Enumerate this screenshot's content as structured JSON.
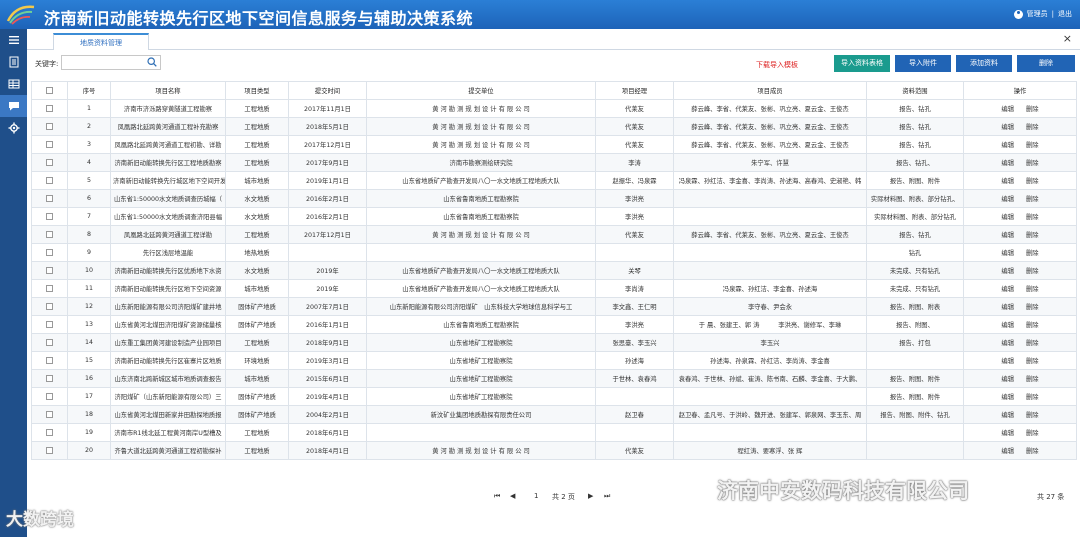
{
  "header": {
    "title": "济南新旧动能转换先行区地下空间信息服务与辅助决策系统",
    "user": "管理员",
    "logout": "退出"
  },
  "sidebar": {
    "items": [
      {
        "name": "menu-icon"
      },
      {
        "name": "document-icon"
      },
      {
        "name": "table-icon"
      },
      {
        "name": "chat-icon"
      },
      {
        "name": "gear-icon"
      }
    ]
  },
  "tab": {
    "label": "地质资料管理",
    "close": "×"
  },
  "toolbar": {
    "keyword_label": "关键字:",
    "keyword_value": "",
    "download_template": "下载导入模板",
    "import_table": "导入资料表格",
    "import_attach": "导入附件",
    "add": "添加资料",
    "delete": "删除"
  },
  "table": {
    "headers": [
      "",
      "序号",
      "项目名称",
      "项目类型",
      "提交时间",
      "提交单位",
      "项目经理",
      "项目成员",
      "资料范围",
      "操作"
    ],
    "edit_label": "编辑",
    "delete_label": "删除",
    "rows": [
      [
        "1",
        "济南市济泺路穿黄隧道工程勘察",
        "工程地质",
        "2017年11月1日",
        "黄 河 勘 测 规 划 设 计 有 限 公 司",
        "代莱友",
        "薛云峰、李省、代莱友、张彬、巩立亮、夏云金、王俊杰",
        "报告、钻孔"
      ],
      [
        "2",
        "凤凰路北延跨黄河通道工程补充勘察",
        "工程地质",
        "2018年5月1日",
        "黄 河 勘 测 规 划 设 计 有 限 公 司",
        "代莱友",
        "薛云峰、李省、代莱友、张彬、巩立亮、夏云金、王俊杰",
        "报告、钻孔"
      ],
      [
        "3",
        "凤凰路北延跨黄河通道工程初勘、详勘",
        "工程地质",
        "2017年12月1日",
        "黄 河 勘 测 规 划 设 计 有 限 公 司",
        "代莱友",
        "薛云峰、李省、代莱友、张彬、巩立亮、夏云金、王俊杰",
        "报告、钻孔"
      ],
      [
        "4",
        "济南新旧动能转换先行区工程地质勘察",
        "工程地质",
        "2017年9月1日",
        "济南市勘察测绘研究院",
        "李涛",
        "朱宁军、许慧",
        "报告、钻孔、"
      ],
      [
        "5",
        "济南新旧动能转换先行城区地下空间开发",
        "城市地质",
        "2019年1月1日",
        "山东省地质矿产勘查开发局八〇一水文地质工程地质大队",
        "赵振华、冯泉霖",
        "冯泉霖、孙红洁、李金喜、李尚涛、孙述海、高春鸿、史淑艳、韩",
        "报告、附图、附件"
      ],
      [
        "6",
        "山东省1:50000水文地质调查历城幅（",
        "水文地质",
        "2016年2月1日",
        "山东省鲁南地质工程勘察院",
        "李洪亮",
        "",
        "实际材料图、附表、部分钻孔、"
      ],
      [
        "7",
        "山东省1:50000水文地质调查济阳县幅",
        "水文地质",
        "2016年2月1日",
        "山东省鲁南地质工程勘察院",
        "李洪亮",
        "",
        "实际材料图、附表、部分钻孔"
      ],
      [
        "8",
        "凤凰路北延跨黄河通道工程详勘",
        "工程地质",
        "2017年12月1日",
        "黄 河 勘 测 规 划 设 计 有 限 公 司",
        "代莱友",
        "薛云峰、李省、代莱友、张彬、巩立亮、夏云金、王俊杰",
        "报告、钻孔"
      ],
      [
        "9",
        "先行区浅层地温能",
        "地热地质",
        "",
        "",
        "",
        "",
        "钻孔"
      ],
      [
        "10",
        "济南新旧动能转换先行区优质地下水资",
        "水文地质",
        "2019年",
        "山东省地质矿产勘查开发局八〇一水文地质工程地质大队",
        "关琴",
        "",
        "未完成、只有钻孔"
      ],
      [
        "11",
        "济南新旧动能转换先行区地下空间资源",
        "城市地质",
        "2019年",
        "山东省地质矿产勘查开发局八〇一水文地质工程地质大队",
        "李尚涛",
        "冯泉霖、孙红洁、李金喜、孙述海",
        "未完成、只有钻孔"
      ],
      [
        "12",
        "山东新阳能源有限公司济阳煤矿建井地",
        "固体矿产地质",
        "2007年7月1日",
        "山东新阳能源有限公司济阳煤矿　山东科技大学地球信息科学与工",
        "李文鑫、王仁明",
        "李守春、尹会永",
        "报告、附图、附表"
      ],
      [
        "13",
        "山东省黄河北煤田济阳煤矿资源储量核",
        "固体矿产地质",
        "2016年1月1日",
        "山东省鲁南地质工程勘察院",
        "李洪亮",
        "于 晨、张建王、郭 涛　　　李洪亮、谢修军、李琳",
        "报告、附图、"
      ],
      [
        "14",
        "山东重工集团黄河建设制造产业园项目",
        "工程地质",
        "2018年9月1日",
        "山东省地矿工程勘察院",
        "张思臺、李玉兴",
        "李玉兴",
        "报告、打包"
      ],
      [
        "15",
        "济南新旧动能转换先行区崔寨片区地质",
        "环境地质",
        "2019年3月1日",
        "山东省地矿工程勘察院",
        "孙述海",
        "孙述海、孙泉霖、孙红洁、李尚涛、李金喜",
        ""
      ],
      [
        "16",
        "山东济南北跨新城区城市地质调查报告",
        "城市地质",
        "2015年6月1日",
        "山东省地矿工程勘察院",
        "于世林、袁春鸿",
        "袁春鸿、于世林、孙斌、崔涛、陈书南、石麟、李金喜、于大鹏、",
        "报告、附图、附件"
      ],
      [
        "17",
        "济阳煤矿（山东新阳能源有限公司）三",
        "固体矿产地质",
        "2019年4月1日",
        "山东省地矿工程勘察院",
        "",
        "",
        "报告、附图、附件"
      ],
      [
        "18",
        "山东省黄河北煤田新家井田勘探地质报",
        "固体矿产地质",
        "2004年2月1日",
        "新汶矿业集团地质勘探有限责任公司",
        "赵卫春",
        "赵卫春、孟凡号、于洪岭、魏开进、张建军、郭泉网、李玉东、周",
        "报告、附图、附件、钻孔"
      ],
      [
        "19",
        "济南市R1线北延工程黄河南岸U型槽及",
        "工程地质",
        "2018年6月1日",
        "",
        "",
        "",
        ""
      ],
      [
        "20",
        "齐鲁大道北延跨黄河通道工程初勘探补",
        "工程地质",
        "2018年4月1日",
        "黄 河 勘 测 规 划 设 计 有 限 公 司",
        "代莱友",
        "程红涛、要寒浮、张 辉",
        ""
      ]
    ]
  },
  "pager": {
    "first": "⏮",
    "prev": "◀",
    "page": "1",
    "total_pages": "共 2 页",
    "next": "▶",
    "last": "⏭",
    "total_items": "共 27 条"
  },
  "watermark": {
    "left": "大数跨境",
    "right": "济南中安数码科技有限公司"
  }
}
